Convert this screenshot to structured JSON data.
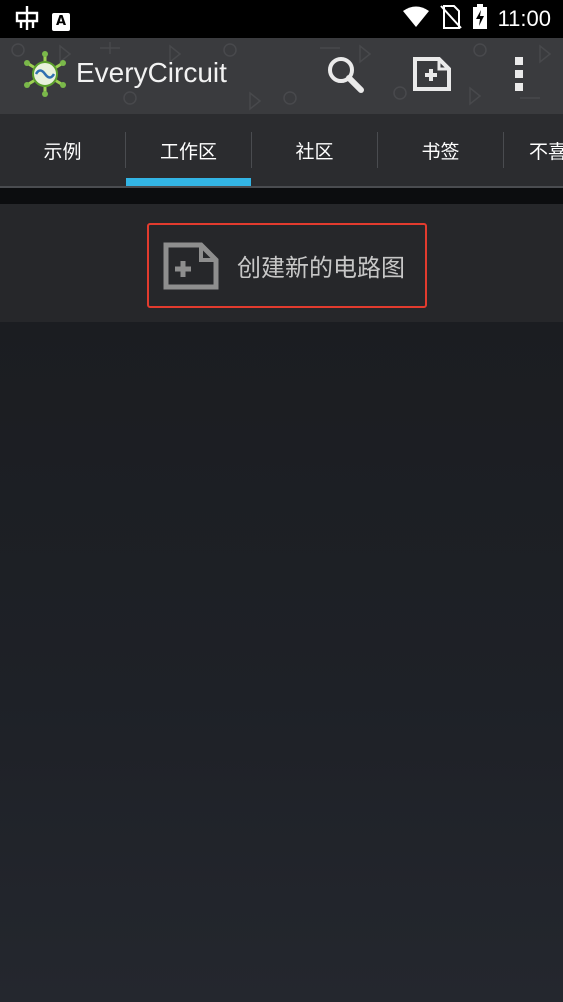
{
  "statusbar": {
    "time": "11:00",
    "icons": [
      "bug-icon",
      "keyboard-a-icon",
      "wifi-icon",
      "no-sim-icon",
      "battery-charging-icon"
    ]
  },
  "appbar": {
    "title": "EveryCircuit",
    "actions": [
      "search-icon",
      "new-circuit-icon",
      "overflow-menu-icon"
    ]
  },
  "tabs": [
    {
      "label": "示例"
    },
    {
      "label": "工作区",
      "selected": true
    },
    {
      "label": "社区"
    },
    {
      "label": "书签"
    },
    {
      "label": "不喜"
    }
  ],
  "create": {
    "label": "创建新的电路图",
    "icon": "new-circuit-icon",
    "highlight_color": "#e23b2e"
  },
  "colors": {
    "accent": "#33b5e5",
    "appbar": "#3a3b3e",
    "background": "#1d2025"
  }
}
